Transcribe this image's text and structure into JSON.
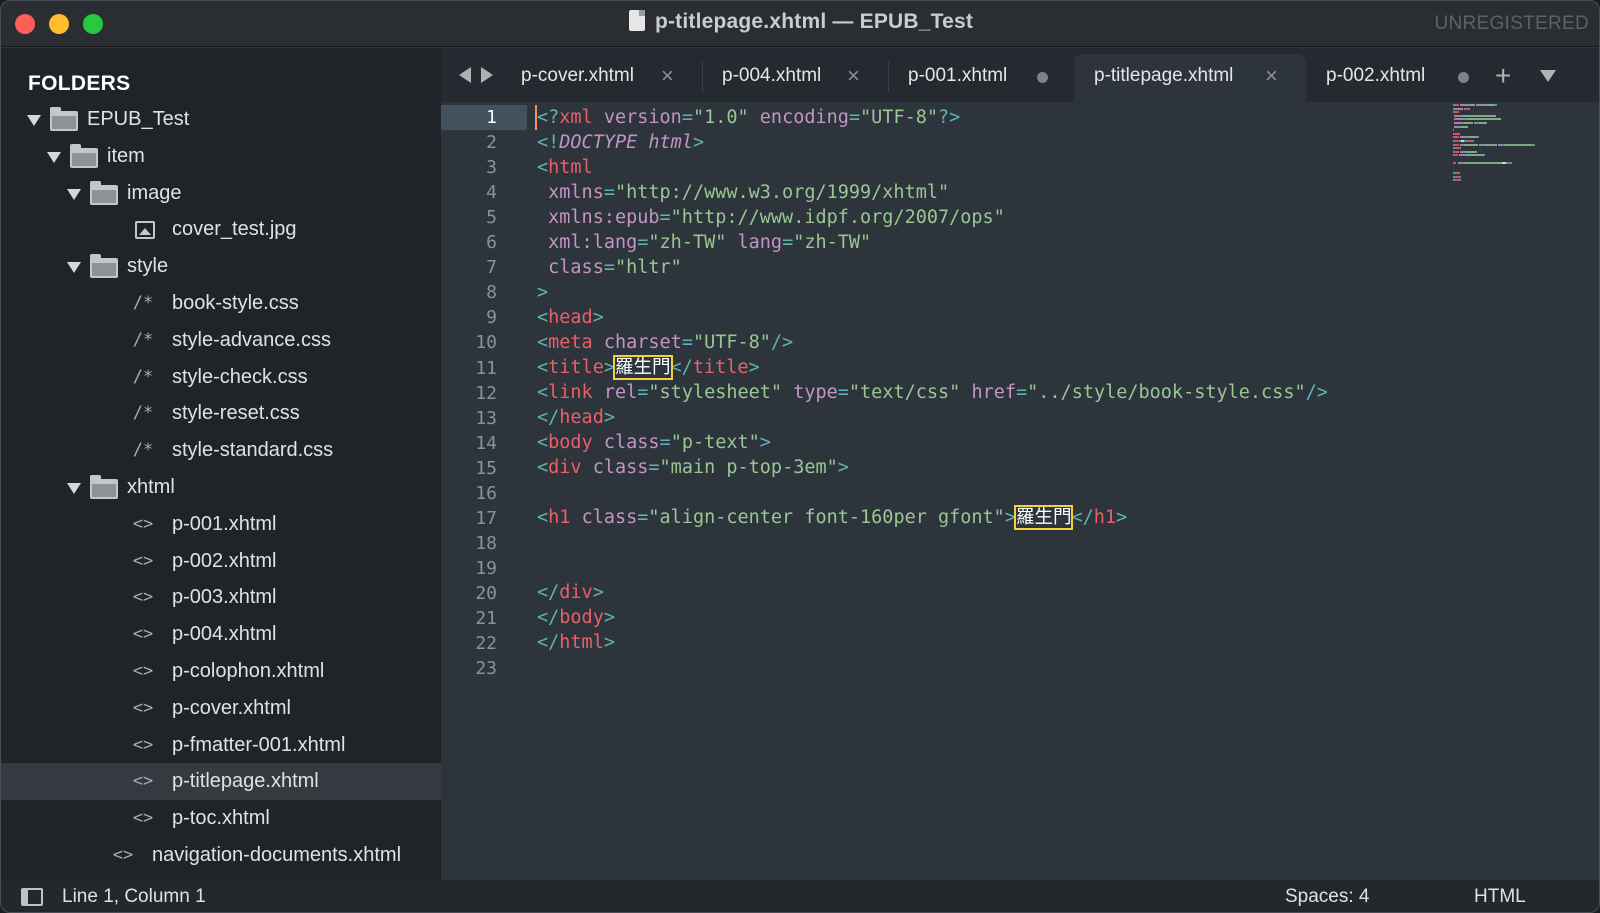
{
  "window": {
    "title": "p-titlepage.xhtml — EPUB_Test",
    "badge": "UNREGISTERED"
  },
  "sidebar": {
    "header": "FOLDERS",
    "tree": [
      {
        "label": "EPUB_Test",
        "kind": "folder",
        "depth": 0,
        "expanded": true
      },
      {
        "label": "item",
        "kind": "folder",
        "depth": 1,
        "expanded": true
      },
      {
        "label": "image",
        "kind": "folder",
        "depth": 2,
        "expanded": true
      },
      {
        "label": "cover_test.jpg",
        "kind": "image",
        "depth": 3,
        "glyph": ""
      },
      {
        "label": "style",
        "kind": "folder",
        "depth": 2,
        "expanded": true
      },
      {
        "label": "book-style.css",
        "kind": "file",
        "depth": 3,
        "glyph": "/*"
      },
      {
        "label": "style-advance.css",
        "kind": "file",
        "depth": 3,
        "glyph": "/*"
      },
      {
        "label": "style-check.css",
        "kind": "file",
        "depth": 3,
        "glyph": "/*"
      },
      {
        "label": "style-reset.css",
        "kind": "file",
        "depth": 3,
        "glyph": "/*"
      },
      {
        "label": "style-standard.css",
        "kind": "file",
        "depth": 3,
        "glyph": "/*"
      },
      {
        "label": "xhtml",
        "kind": "folder",
        "depth": 2,
        "expanded": true
      },
      {
        "label": "p-001.xhtml",
        "kind": "file",
        "depth": 3,
        "glyph": "<>"
      },
      {
        "label": "p-002.xhtml",
        "kind": "file",
        "depth": 3,
        "glyph": "<>"
      },
      {
        "label": "p-003.xhtml",
        "kind": "file",
        "depth": 3,
        "glyph": "<>"
      },
      {
        "label": "p-004.xhtml",
        "kind": "file",
        "depth": 3,
        "glyph": "<>"
      },
      {
        "label": "p-colophon.xhtml",
        "kind": "file",
        "depth": 3,
        "glyph": "<>"
      },
      {
        "label": "p-cover.xhtml",
        "kind": "file",
        "depth": 3,
        "glyph": "<>"
      },
      {
        "label": "p-fmatter-001.xhtml",
        "kind": "file",
        "depth": 3,
        "glyph": "<>"
      },
      {
        "label": "p-titlepage.xhtml",
        "kind": "file",
        "depth": 3,
        "glyph": "<>",
        "selected": true
      },
      {
        "label": "p-toc.xhtml",
        "kind": "file",
        "depth": 3,
        "glyph": "<>"
      },
      {
        "label": "navigation-documents.xhtml",
        "kind": "file",
        "depth": 2,
        "glyph": "<>"
      }
    ]
  },
  "tabs": [
    {
      "label": "p-cover.xhtml",
      "state": "close"
    },
    {
      "label": "p-004.xhtml",
      "state": "close"
    },
    {
      "label": "p-001.xhtml",
      "state": "dirty"
    },
    {
      "label": "p-titlepage.xhtml",
      "state": "close",
      "active": true
    },
    {
      "label": "p-002.xhtml",
      "state": "dirty"
    }
  ],
  "editor": {
    "active_line": 1,
    "lines": [
      [
        [
          "p",
          "<?"
        ],
        [
          "t",
          "xml"
        ],
        [
          "x",
          " "
        ],
        [
          "a",
          "version"
        ],
        [
          "p",
          "="
        ],
        [
          "s",
          "\"1.0\""
        ],
        [
          "x",
          " "
        ],
        [
          "a",
          "encoding"
        ],
        [
          "p",
          "="
        ],
        [
          "s",
          "\"UTF-8\""
        ],
        [
          "p",
          "?>"
        ]
      ],
      [
        [
          "p",
          "<!"
        ],
        [
          "k",
          "DOCTYPE"
        ],
        [
          "x",
          " "
        ],
        [
          "kt",
          "html"
        ],
        [
          "p",
          ">"
        ]
      ],
      [
        [
          "p",
          "<"
        ],
        [
          "t",
          "html"
        ]
      ],
      [
        [
          "x",
          " "
        ],
        [
          "a",
          "xmlns"
        ],
        [
          "p",
          "="
        ],
        [
          "s",
          "\"http://www.w3.org/1999/xhtml\""
        ]
      ],
      [
        [
          "x",
          " "
        ],
        [
          "a",
          "xmlns:epub"
        ],
        [
          "p",
          "="
        ],
        [
          "s",
          "\"http://www.idpf.org/2007/ops\""
        ]
      ],
      [
        [
          "x",
          " "
        ],
        [
          "a",
          "xml:lang"
        ],
        [
          "p",
          "="
        ],
        [
          "s",
          "\"zh-TW\""
        ],
        [
          "x",
          " "
        ],
        [
          "a",
          "lang"
        ],
        [
          "p",
          "="
        ],
        [
          "s",
          "\"zh-TW\""
        ]
      ],
      [
        [
          "x",
          " "
        ],
        [
          "a",
          "class"
        ],
        [
          "p",
          "="
        ],
        [
          "s",
          "\"hltr\""
        ]
      ],
      [
        [
          "p",
          ">"
        ]
      ],
      [
        [
          "p",
          "<"
        ],
        [
          "t",
          "head"
        ],
        [
          "p",
          ">"
        ]
      ],
      [
        [
          "p",
          "<"
        ],
        [
          "t",
          "meta"
        ],
        [
          "x",
          " "
        ],
        [
          "a",
          "charset"
        ],
        [
          "p",
          "="
        ],
        [
          "s",
          "\"UTF-8\""
        ],
        [
          "p",
          "/>"
        ]
      ],
      [
        [
          "p",
          "<"
        ],
        [
          "t",
          "title"
        ],
        [
          "p",
          ">"
        ],
        [
          "h",
          "羅生門"
        ],
        [
          "p",
          "</"
        ],
        [
          "t",
          "title"
        ],
        [
          "p",
          ">"
        ]
      ],
      [
        [
          "p",
          "<"
        ],
        [
          "t",
          "link"
        ],
        [
          "x",
          " "
        ],
        [
          "a",
          "rel"
        ],
        [
          "p",
          "="
        ],
        [
          "s",
          "\"stylesheet\""
        ],
        [
          "x",
          " "
        ],
        [
          "a",
          "type"
        ],
        [
          "p",
          "="
        ],
        [
          "s",
          "\"text/css\""
        ],
        [
          "x",
          " "
        ],
        [
          "a",
          "href"
        ],
        [
          "p",
          "="
        ],
        [
          "s",
          "\"../style/book-style.css\""
        ],
        [
          "p",
          "/>"
        ]
      ],
      [
        [
          "p",
          "</"
        ],
        [
          "t",
          "head"
        ],
        [
          "p",
          ">"
        ]
      ],
      [
        [
          "p",
          "<"
        ],
        [
          "t",
          "body"
        ],
        [
          "x",
          " "
        ],
        [
          "a",
          "class"
        ],
        [
          "p",
          "="
        ],
        [
          "s",
          "\"p-text\""
        ],
        [
          "p",
          ">"
        ]
      ],
      [
        [
          "p",
          "<"
        ],
        [
          "t",
          "div"
        ],
        [
          "x",
          " "
        ],
        [
          "a",
          "class"
        ],
        [
          "p",
          "="
        ],
        [
          "s",
          "\"main p-top-3em\""
        ],
        [
          "p",
          ">"
        ]
      ],
      [],
      [
        [
          "p",
          "<"
        ],
        [
          "t",
          "h1"
        ],
        [
          "x",
          " "
        ],
        [
          "a",
          "class"
        ],
        [
          "p",
          "="
        ],
        [
          "s",
          "\"align-center font-160per gfont\""
        ],
        [
          "p",
          ">"
        ],
        [
          "h",
          "羅生門"
        ],
        [
          "p",
          "</"
        ],
        [
          "t",
          "h1"
        ],
        [
          "p",
          ">"
        ]
      ],
      [],
      [],
      [
        [
          "p",
          "</"
        ],
        [
          "t",
          "div"
        ],
        [
          "p",
          ">"
        ]
      ],
      [
        [
          "p",
          "</"
        ],
        [
          "t",
          "body"
        ],
        [
          "p",
          ">"
        ]
      ],
      [
        [
          "p",
          "</"
        ],
        [
          "t",
          "html"
        ],
        [
          "p",
          ">"
        ]
      ],
      []
    ]
  },
  "status": {
    "position": "Line 1, Column 1",
    "indent": "Spaces: 4",
    "syntax": "HTML"
  }
}
